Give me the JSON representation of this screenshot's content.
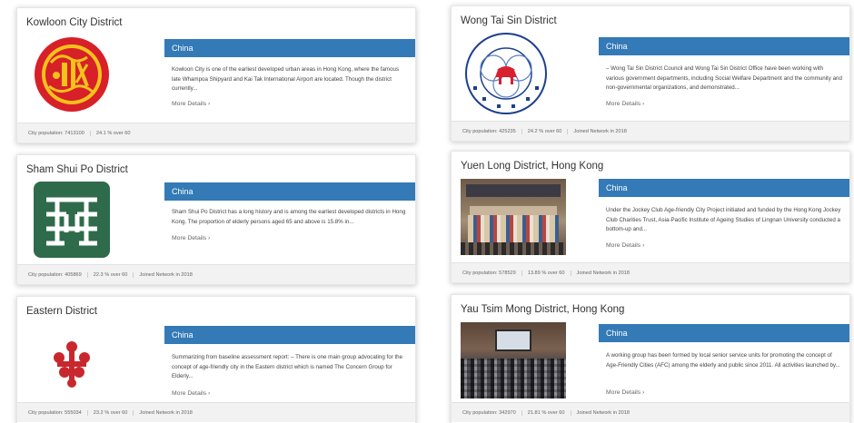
{
  "cards_left": [
    {
      "title": "Kowloon City District",
      "region": "China",
      "description": "Kowloon City is one of the earliest developed urban areas in Hong Kong, where the famous late Whampoa Shipyard and Kai Tak International Airport are located. Though the district currently...",
      "more": "More Details ›",
      "footer": [
        "City population: 7413100",
        "24.1 % over 60"
      ],
      "logo_icon": "kowloon-city-seal-icon",
      "logo_color": "#d82029"
    },
    {
      "title": "Sham Shui Po District",
      "region": "China",
      "description": "Sham Shui Po District has a long history and is among the earliest developed districts in Hong Kong. The proportion of elderly persons aged 65 and above is 15.8% in...",
      "more": "More Details ›",
      "footer": [
        "City population: 405869",
        "22.3 % over 60",
        "Joined Network in 2018"
      ],
      "logo_icon": "sham-shui-po-logo-icon",
      "logo_color": "#2e6b4b"
    },
    {
      "title": "Eastern District",
      "region": "China",
      "description": "Summarizing from baseline assessment report: – There is one main group advocating for the concept of age-friendly city in the Eastern district which is named The Concern Group for Elderly...",
      "more": "More Details ›",
      "footer": [
        "City population: 555034",
        "23.2 % over 60",
        "Joined Network in 2018"
      ],
      "logo_icon": "eastern-district-logo-icon",
      "logo_color": "#c8282d"
    }
  ],
  "cards_right": [
    {
      "title": "Wong Tai Sin District",
      "region": "China",
      "description": "– Wong Tai Sin District Council and Wong Tai Sin District Office have been working with various government departments, including Social Welfare Department and the community and non-governmental organizations, and demonstrated...",
      "more": "More Details ›",
      "footer": [
        "City population: 425235",
        "24.2 % over 60",
        "Joined Network in 2018"
      ],
      "logo_icon": "wong-tai-sin-council-seal-icon",
      "logo_color": "#1d3f8f",
      "logo_text": "W.T.S. DISTRICT COUNCIL"
    },
    {
      "title": "Yuen Long District, Hong Kong",
      "region": "China",
      "description": "Under the Jockey Club Age-friendly City Project initiated and funded by the Hong Kong Jockey Club Charities Trust, Asia-Pacific Institute of Ageing Studies of Lingnan University conducted a bottom-up and...",
      "more": "More Details ›",
      "footer": [
        "City population: 578529",
        "13.89 % over 60",
        "Joined Network in 2018"
      ],
      "logo_icon": "group-photo-image"
    },
    {
      "title": "Yau Tsim Mong District, Hong Kong",
      "region": "China",
      "description": "A working group has been formed by local senior service units for promoting the concept of Age-Friendly Cities (AFC) among the elderly and public since 2011. All activities launched by...",
      "more": "More Details ›",
      "footer": [
        "City population: 342970",
        "21.81 % over 60",
        "Joined Network in 2018"
      ],
      "logo_icon": "auditorium-photo-image"
    }
  ]
}
